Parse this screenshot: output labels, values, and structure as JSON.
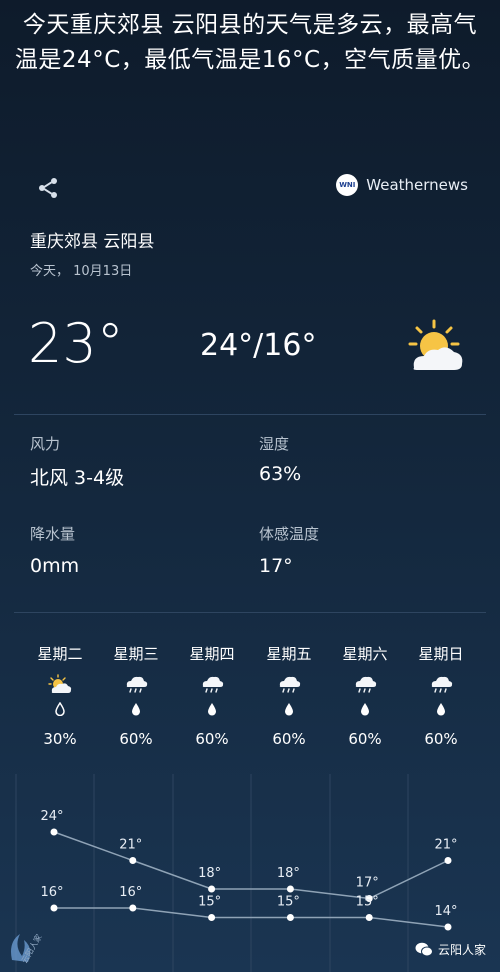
{
  "headline": "今天重庆郊县 云阳县的天气是多云，最高气温是24°C，最低气温是16°C，空气质量优。",
  "brand": {
    "logo_text": "WNI",
    "name": "Weathernews"
  },
  "location": "重庆郊县 云阳县",
  "date": "今天，  10月13日",
  "current": {
    "temp": "23°",
    "range": "24°/16°",
    "condition_icon": "partly-cloudy-icon"
  },
  "details": [
    {
      "label": "风力",
      "value": "北风  3-4级"
    },
    {
      "label": "湿度",
      "value": "63%"
    },
    {
      "label": "降水量",
      "value": "0mm"
    },
    {
      "label": "体感温度",
      "value": "17°"
    }
  ],
  "forecast": [
    {
      "day": "星期二",
      "icon": "partly-cloudy-icon",
      "pop": "30%"
    },
    {
      "day": "星期三",
      "icon": "rain-cloud-icon",
      "pop": "60%"
    },
    {
      "day": "星期四",
      "icon": "rain-cloud-icon",
      "pop": "60%"
    },
    {
      "day": "星期五",
      "icon": "rain-cloud-icon",
      "pop": "60%"
    },
    {
      "day": "星期六",
      "icon": "rain-cloud-icon",
      "pop": "60%"
    },
    {
      "day": "星期日",
      "icon": "rain-cloud-icon",
      "pop": "60%"
    }
  ],
  "chart_data": {
    "type": "line",
    "categories": [
      "星期二",
      "星期三",
      "星期四",
      "星期五",
      "星期六",
      "星期日"
    ],
    "series": [
      {
        "values": [
          24,
          21,
          18,
          18,
          17,
          21
        ]
      },
      {
        "values": [
          16,
          16,
          15,
          15,
          15,
          14
        ]
      }
    ],
    "unit_suffix": "°"
  },
  "footer": {
    "brand": "云阳人家",
    "logo_text": "云阳人家"
  },
  "colors": {
    "line": "#8fa3b6",
    "dot": "#ffffff",
    "grid": "#2e4560",
    "sun": "#f6c445"
  }
}
